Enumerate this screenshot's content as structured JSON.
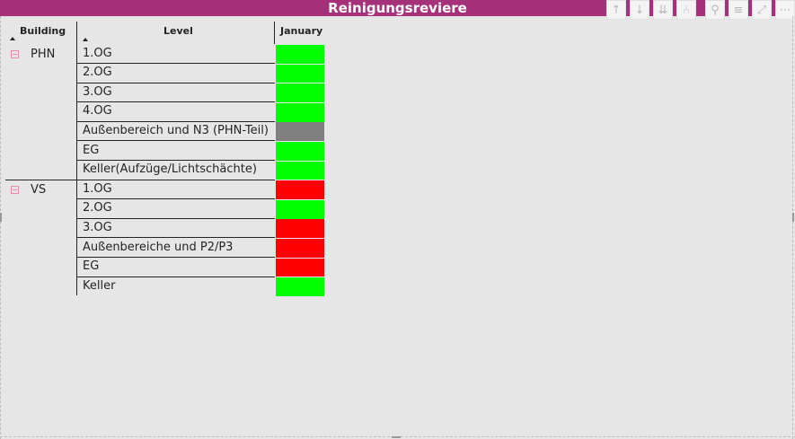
{
  "visual": {
    "title": "Reinigungsreviere"
  },
  "toolbar": [
    {
      "name": "drill-up-icon",
      "glyph": "↑"
    },
    {
      "name": "drill-down-icon",
      "glyph": "↓"
    },
    {
      "name": "expand-all-down-icon",
      "glyph": "⇊"
    },
    {
      "name": "drill-hierarchy-icon",
      "glyph": "⑃"
    },
    {
      "name": "pin-icon",
      "glyph": "⚲"
    },
    {
      "name": "filter-icon",
      "glyph": "≡"
    },
    {
      "name": "focus-mode-icon",
      "glyph": "⤢"
    },
    {
      "name": "more-options-icon",
      "glyph": "⋯"
    }
  ],
  "matrix": {
    "headers": {
      "building": "Building",
      "level": "Level",
      "month": "January"
    },
    "colors": {
      "green": "#00ff00",
      "red": "#ff0000",
      "gray": "#808080"
    },
    "groups": [
      {
        "building": "PHN",
        "rows": [
          {
            "level": "1.OG",
            "status": "green"
          },
          {
            "level": "2.OG",
            "status": "green"
          },
          {
            "level": "3.OG",
            "status": "green"
          },
          {
            "level": "4.OG",
            "status": "green"
          },
          {
            "level": "Außenbereich und N3 (PHN-Teil)",
            "status": "gray"
          },
          {
            "level": "EG",
            "status": "green"
          },
          {
            "level": "Keller(Aufzüge/Lichtschächte)",
            "status": "green"
          }
        ]
      },
      {
        "building": "VS",
        "rows": [
          {
            "level": "1.OG",
            "status": "red"
          },
          {
            "level": "2.OG",
            "status": "green"
          },
          {
            "level": "3.OG",
            "status": "red"
          },
          {
            "level": "Außenbereiche und P2/P3",
            "status": "red"
          },
          {
            "level": "EG",
            "status": "red"
          },
          {
            "level": "Keller",
            "status": "green"
          }
        ]
      }
    ]
  }
}
